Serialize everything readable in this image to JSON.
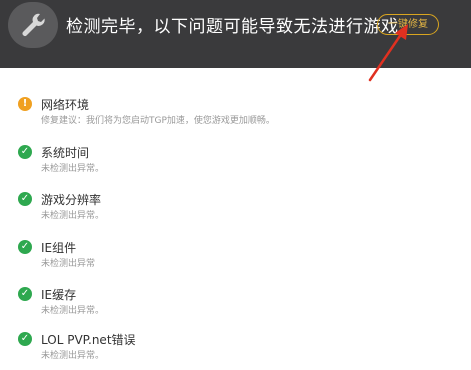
{
  "header": {
    "title": "检测完毕，以下问题可能导致无法进行游戏",
    "fix_button": "一键修复"
  },
  "items": [
    {
      "title": "网络环境",
      "desc": "修复建议：我们将为您启动TGP加速，使您游戏更加顺畅。",
      "status": "warning"
    },
    {
      "title": "系统时间",
      "desc": "未检测出异常。",
      "status": "ok"
    },
    {
      "title": "游戏分辨率",
      "desc": "未检测出异常。",
      "status": "ok"
    },
    {
      "title": "IE组件",
      "desc": "未检测出异常",
      "status": "ok"
    },
    {
      "title": "IE缓存",
      "desc": "未检测出异常。",
      "status": "ok"
    },
    {
      "title": "LOL PVP.net错误",
      "desc": "未检测出异常。",
      "status": "ok"
    }
  ],
  "colors": {
    "header_bg": "#3a3a3c",
    "accent": "#d9a520",
    "ok": "#2ea84f",
    "warning": "#f0a020",
    "annotation_arrow": "#e03020"
  }
}
